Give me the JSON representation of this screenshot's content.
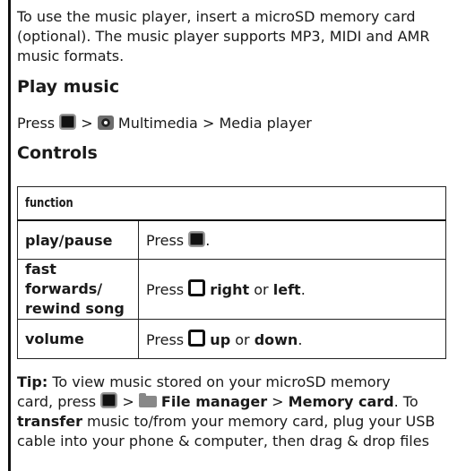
{
  "intro": "To use the music player, insert a microSD memory card (optional). The music player supports MP3, MIDI and AMR music formats.",
  "play_music": {
    "heading": "Play music",
    "press": "Press",
    "sep1": ">",
    "menu1": "Multimedia",
    "sep2": ">",
    "menu2": "Media player",
    "icons": [
      "menu-key-icon",
      "multimedia-icon"
    ]
  },
  "controls": {
    "heading": "Controls",
    "table": {
      "header": "function",
      "rows": [
        {
          "fn": "play/pause",
          "desc_pre": "Press",
          "desc_post": "."
        },
        {
          "fn_line1": "fast forwards/",
          "fn_line2": "rewind song",
          "desc_pre": "Press",
          "key1": "right",
          "or": "or",
          "key2": "left",
          "end": "."
        },
        {
          "fn": "volume",
          "desc_pre": "Press",
          "key1": "up",
          "or": "or",
          "key2": "down",
          "end": "."
        }
      ]
    }
  },
  "tip": {
    "label": "Tip:",
    "line1": "To view music stored on your microSD memory",
    "line2_pre": "card, press",
    "gt1": ">",
    "file_manager": "File manager",
    "gt2": ">",
    "memory_card": "Memory card",
    "line2_post": ". To",
    "transfer": "transfer",
    "line3_post": "music to/from your memory card, plug your USB",
    "line4": "cable into your phone & computer, then drag & drop files"
  }
}
